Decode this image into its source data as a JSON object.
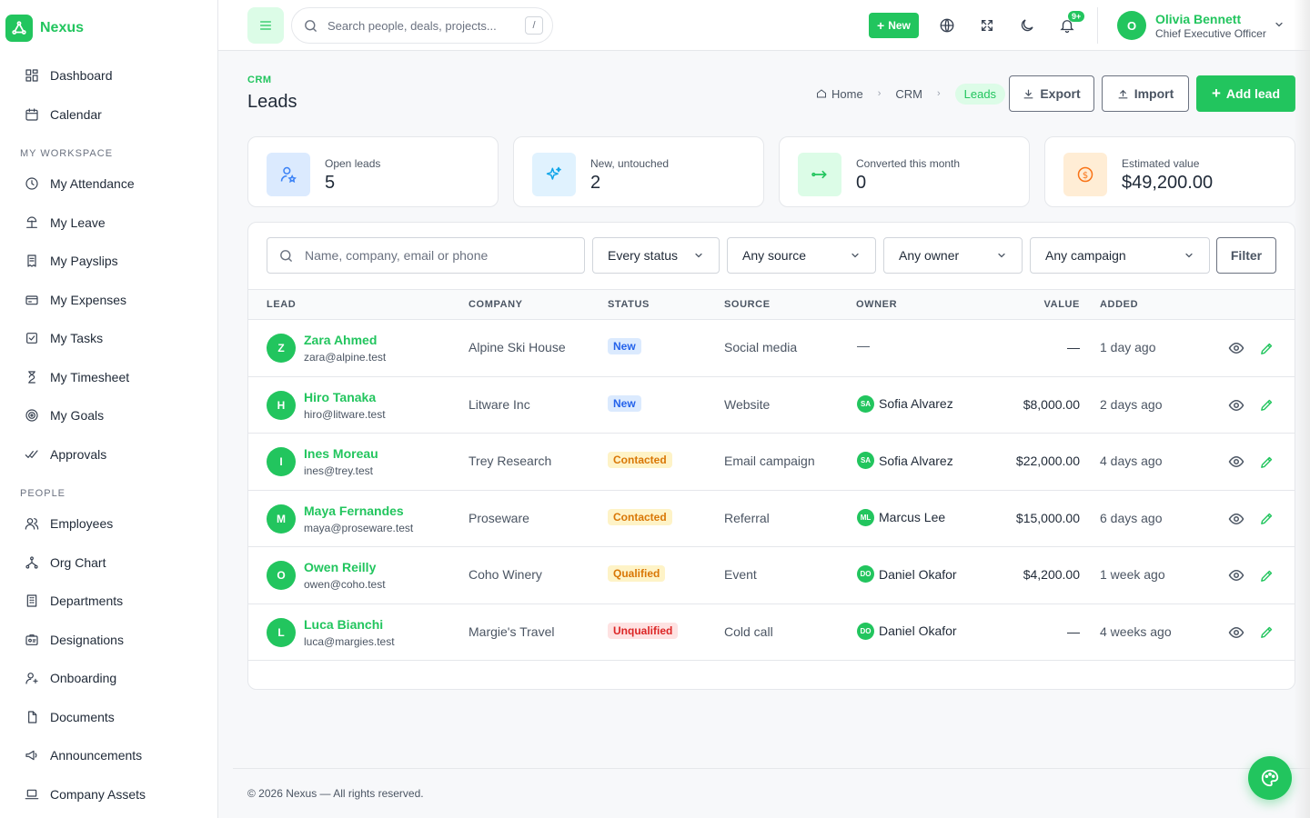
{
  "brand": {
    "name": "Nexus"
  },
  "sidebar": {
    "top_items": [
      {
        "label": "Dashboard",
        "icon": "dashboard-icon"
      },
      {
        "label": "Calendar",
        "icon": "calendar-icon"
      }
    ],
    "section_workspace": "MY WORKSPACE",
    "workspace_items": [
      {
        "label": "My Attendance",
        "icon": "clock-icon"
      },
      {
        "label": "My Leave",
        "icon": "beach-icon"
      },
      {
        "label": "My Payslips",
        "icon": "receipt-icon"
      },
      {
        "label": "My Expenses",
        "icon": "card-icon"
      },
      {
        "label": "My Tasks",
        "icon": "checkbox-icon"
      },
      {
        "label": "My Timesheet",
        "icon": "hourglass-icon"
      },
      {
        "label": "My Goals",
        "icon": "target-icon"
      },
      {
        "label": "Approvals",
        "icon": "double-check-icon"
      }
    ],
    "section_people": "PEOPLE",
    "people_items": [
      {
        "label": "Employees",
        "icon": "users-icon"
      },
      {
        "label": "Org Chart",
        "icon": "hierarchy-icon"
      },
      {
        "label": "Departments",
        "icon": "building-icon"
      },
      {
        "label": "Designations",
        "icon": "id-badge-icon"
      },
      {
        "label": "Onboarding",
        "icon": "user-plus-icon"
      },
      {
        "label": "Documents",
        "icon": "document-icon"
      },
      {
        "label": "Announcements",
        "icon": "megaphone-icon"
      },
      {
        "label": "Company Assets",
        "icon": "laptop-icon"
      }
    ]
  },
  "topbar": {
    "search_placeholder": "Search people, deals, projects...",
    "search_shortcut": "/",
    "new_label": "New",
    "notif_count": "9+",
    "user": {
      "initial": "O",
      "name": "Olivia Bennett",
      "role": "Chief Executive Officer"
    }
  },
  "page": {
    "section": "CRM",
    "title": "Leads",
    "breadcrumb": [
      "Home",
      "CRM",
      "Leads"
    ],
    "buttons": {
      "export": "Export",
      "import": "Import",
      "add": "Add lead"
    }
  },
  "stats": [
    {
      "label": "Open leads",
      "value": "5",
      "color": "#3b82f6",
      "bg": "#dbeafe"
    },
    {
      "label": "New, untouched",
      "value": "2",
      "color": "#0ea5e9",
      "bg": "#e0f2fe"
    },
    {
      "label": "Converted this month",
      "value": "0",
      "color": "#22c55e",
      "bg": "#dcfce7"
    },
    {
      "label": "Estimated value",
      "value": "$49,200.00",
      "color": "#f97316",
      "bg": "#ffedd5"
    }
  ],
  "filters": {
    "search_placeholder": "Name, company, email or phone",
    "status": "Every status",
    "source": "Any source",
    "owner": "Any owner",
    "campaign": "Any campaign",
    "button": "Filter"
  },
  "table": {
    "headers": {
      "lead": "LEAD",
      "company": "COMPANY",
      "status": "STATUS",
      "source": "SOURCE",
      "owner": "OWNER",
      "value": "VALUE",
      "added": "ADDED"
    },
    "rows": [
      {
        "initial": "Z",
        "name": "Zara Ahmed",
        "email": "zara@alpine.test",
        "company": "Alpine Ski House",
        "status": "New",
        "status_kind": "new",
        "source": "Social media",
        "owner_initials": "",
        "owner": "—",
        "value": "—",
        "added": "1 day ago"
      },
      {
        "initial": "H",
        "name": "Hiro Tanaka",
        "email": "hiro@litware.test",
        "company": "Litware Inc",
        "status": "New",
        "status_kind": "new",
        "source": "Website",
        "owner_initials": "SA",
        "owner": "Sofia Alvarez",
        "value": "$8,000.00",
        "added": "2 days ago"
      },
      {
        "initial": "I",
        "name": "Ines Moreau",
        "email": "ines@trey.test",
        "company": "Trey Research",
        "status": "Contacted",
        "status_kind": "contacted",
        "source": "Email campaign",
        "owner_initials": "SA",
        "owner": "Sofia Alvarez",
        "value": "$22,000.00",
        "added": "4 days ago"
      },
      {
        "initial": "M",
        "name": "Maya Fernandes",
        "email": "maya@proseware.test",
        "company": "Proseware",
        "status": "Contacted",
        "status_kind": "contacted",
        "source": "Referral",
        "owner_initials": "ML",
        "owner": "Marcus Lee",
        "value": "$15,000.00",
        "added": "6 days ago"
      },
      {
        "initial": "O",
        "name": "Owen Reilly",
        "email": "owen@coho.test",
        "company": "Coho Winery",
        "status": "Qualified",
        "status_kind": "qualified",
        "source": "Event",
        "owner_initials": "DO",
        "owner": "Daniel Okafor",
        "value": "$4,200.00",
        "added": "1 week ago"
      },
      {
        "initial": "L",
        "name": "Luca Bianchi",
        "email": "luca@margies.test",
        "company": "Margie's Travel",
        "status": "Unqualified",
        "status_kind": "unqualified",
        "source": "Cold call",
        "owner_initials": "DO",
        "owner": "Daniel Okafor",
        "value": "—",
        "added": "4 weeks ago"
      }
    ]
  },
  "footer": {
    "text": "© 2026 Nexus — All rights reserved."
  },
  "colors": {
    "accent": "#22c55e"
  }
}
